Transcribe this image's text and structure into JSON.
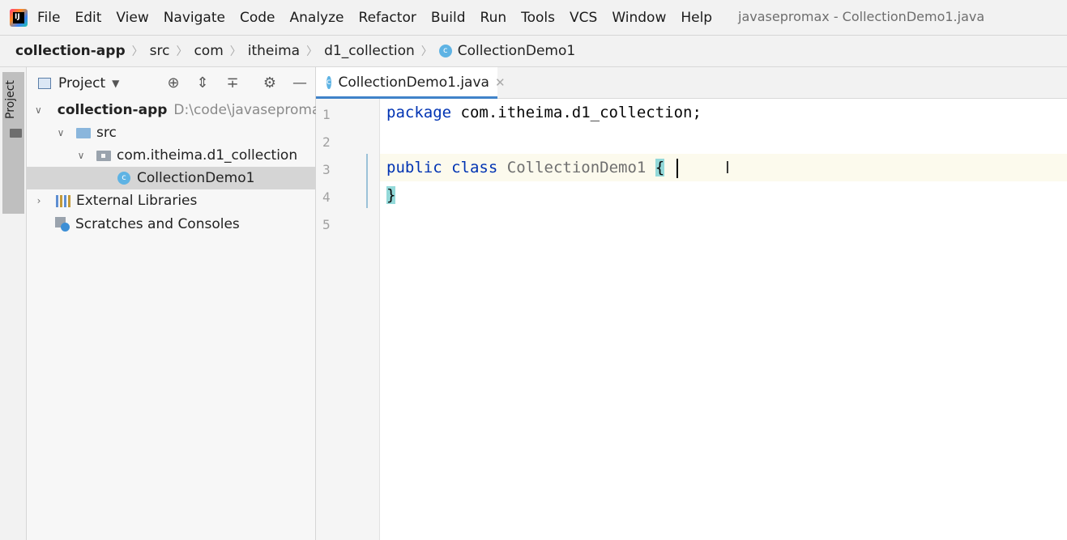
{
  "menubar": {
    "items": [
      "File",
      "Edit",
      "View",
      "Navigate",
      "Code",
      "Analyze",
      "Refactor",
      "Build",
      "Run",
      "Tools",
      "VCS",
      "Window",
      "Help"
    ],
    "window_title": "javasepromax - CollectionDemo1.java"
  },
  "breadcrumb": {
    "items": [
      "collection-app",
      "src",
      "com",
      "itheima",
      "d1_collection",
      "CollectionDemo1"
    ]
  },
  "sidebar": {
    "project_tab": "Project"
  },
  "project_panel": {
    "title": "Project",
    "tree": {
      "root": {
        "label": "collection-app",
        "path": "D:\\code\\javasepromax"
      },
      "src": "src",
      "package": "com.itheima.d1_collection",
      "class_file": "CollectionDemo1",
      "external_libraries": "External Libraries",
      "scratches": "Scratches and Consoles"
    }
  },
  "editor": {
    "tab_label": "CollectionDemo1.java",
    "line_numbers": [
      "1",
      "2",
      "3",
      "4",
      "5"
    ],
    "code": {
      "line1_kw": "package",
      "line1_rest": " com.itheima.d1_collection;",
      "line3_kw1": "public",
      "line3_kw2": "class",
      "line3_name": "CollectionDemo1",
      "line3_brace": "{",
      "line4_brace": "}"
    }
  },
  "colors": {
    "keyword": "#0033b3",
    "class_name": "#6f6f6f",
    "brace_highlight": "#93d9d9",
    "tab_accent": "#4083c9",
    "selection": "#d5d5d5"
  }
}
